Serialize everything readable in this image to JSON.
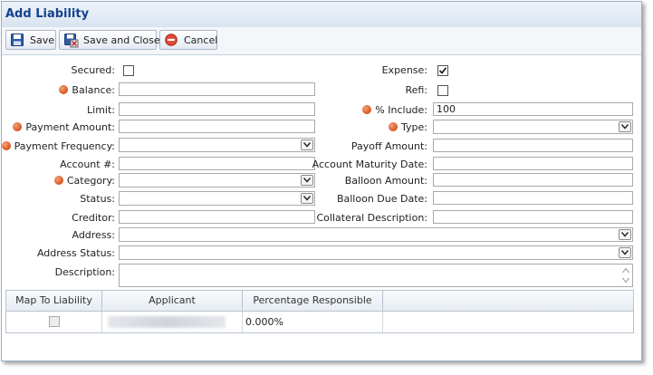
{
  "dialog": {
    "title": "Add Liability"
  },
  "toolbar": {
    "save_label": "Save",
    "save_close_label": "Save and Close",
    "cancel_label": "Cancel"
  },
  "form": {
    "secured_label": "Secured:",
    "secured_checked": false,
    "balance_label": "Balance:",
    "balance_value": "",
    "limit_label": "Limit:",
    "limit_value": "",
    "payment_amount_label": "Payment Amount:",
    "payment_amount_value": "",
    "payment_frequency_label": "Payment Frequency:",
    "payment_frequency_value": "",
    "account_label": "Account #:",
    "account_value": "",
    "category_label": "Category:",
    "category_value": "",
    "status_label": "Status:",
    "status_value": "",
    "creditor_label": "Creditor:",
    "creditor_value": "",
    "expense_label": "Expense:",
    "expense_checked": true,
    "refi_label": "Refi:",
    "refi_checked": false,
    "include_label": "% Include:",
    "include_value": "100",
    "type_label": "Type:",
    "type_value": "",
    "payoff_amount_label": "Payoff Amount:",
    "payoff_amount_value": "",
    "account_maturity_label": "Account Maturity Date:",
    "account_maturity_value": "",
    "balloon_amount_label": "Balloon Amount:",
    "balloon_amount_value": "",
    "balloon_due_label": "Balloon Due Date:",
    "balloon_due_value": "",
    "collateral_label": "Collateral Description:",
    "collateral_value": "",
    "address_label": "Address:",
    "address_value": "",
    "address_status_label": "Address Status:",
    "address_status_value": "",
    "description_label": "Description:",
    "description_value": ""
  },
  "grid": {
    "headers": [
      "Map To Liability",
      "Applicant",
      "Percentage Responsible"
    ],
    "rows": [
      {
        "mapped": false,
        "applicant": "",
        "percentage": "0.000%"
      }
    ]
  },
  "colors": {
    "title_text": "#15428b",
    "required_marker": "#d9531e"
  },
  "icons": {
    "save": "floppy-disk-icon",
    "save_close": "floppy-disk-close-icon",
    "cancel": "cancel-icon"
  }
}
